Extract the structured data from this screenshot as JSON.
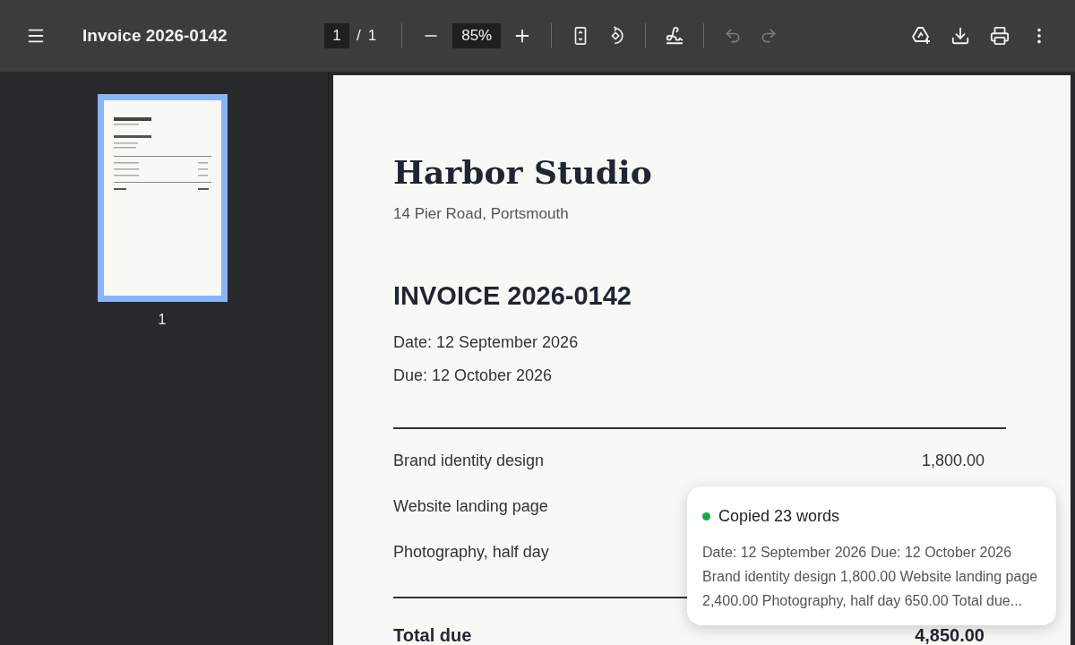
{
  "toolbar": {
    "title": "Invoice 2026-0142",
    "page_input": "1",
    "page_separator": "/",
    "page_total": "1",
    "zoom": "85%",
    "undo": {
      "disabled": true
    },
    "redo": {
      "disabled": true
    }
  },
  "thumbnails": [
    {
      "label": "1",
      "selected": true
    }
  ],
  "document": {
    "company": "Harbor Studio",
    "address": "14 Pier Road, Portsmouth",
    "invoice_title": "INVOICE 2026-0142",
    "date": "Date: 12 September 2026",
    "due": "Due: 12 October 2026",
    "items": [
      {
        "description": "Brand identity design",
        "amount": "1,800.00"
      },
      {
        "description": "Website landing page"
      },
      {
        "description": "Photography, half day"
      }
    ],
    "total_label": "Total due",
    "total_amount": "4,850.00"
  },
  "toast": {
    "title": "Copied 23 words",
    "color": "#1ea446",
    "text": "Date: 12 September 2026 Due: 12 October 2026 Brand identity design 1,800.00 Website landing page 2,400.00 Photography, half day 650.00 Total due..."
  }
}
